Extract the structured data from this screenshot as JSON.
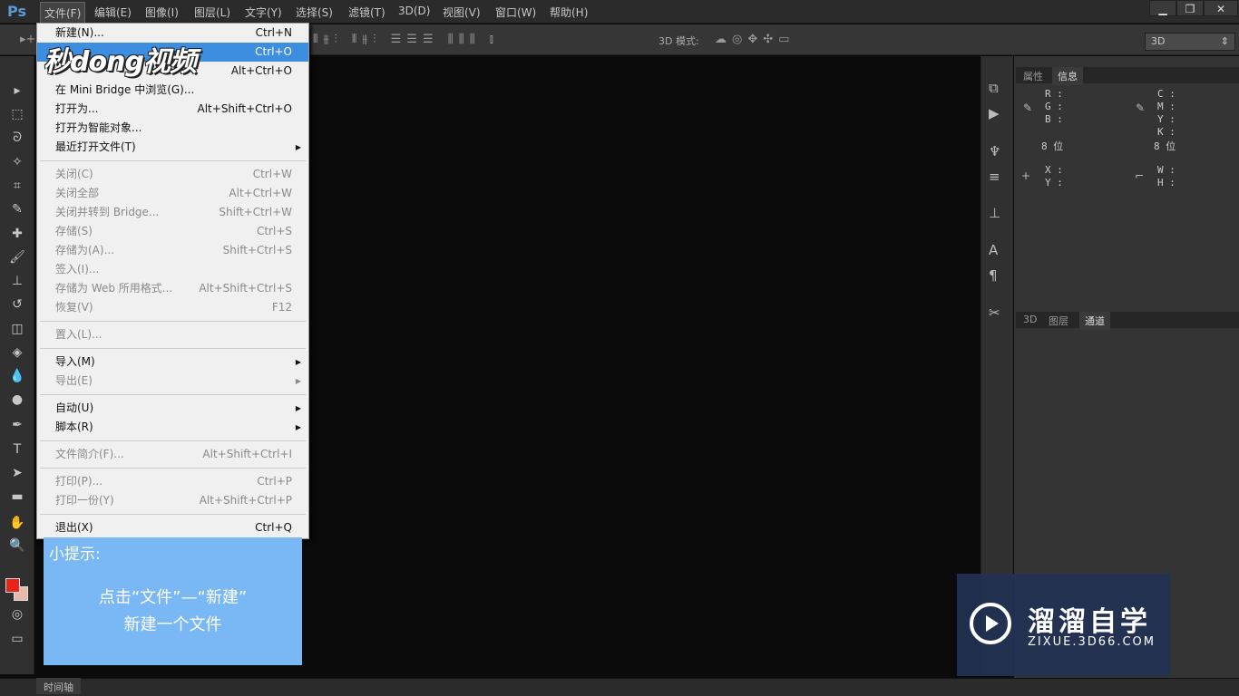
{
  "app": {
    "logo": "Ps"
  },
  "menubar": [
    "文件(F)",
    "编辑(E)",
    "图像(I)",
    "图层(L)",
    "文字(Y)",
    "选择(S)",
    "滤镜(T)",
    "3D(D)",
    "视图(V)",
    "窗口(W)",
    "帮助(H)"
  ],
  "window_controls": {
    "minimize": "▁",
    "restore": "❐",
    "close": "✕"
  },
  "options_bar": {
    "mode_label": "3D 模式:",
    "workspace_select": "3D"
  },
  "file_menu": [
    {
      "label": "新建(N)...",
      "shortcut": "Ctrl+N"
    },
    {
      "label": "",
      "shortcut": "Ctrl+O",
      "highlighted": true
    },
    {
      "label": "",
      "shortcut": "Alt+Ctrl+O"
    },
    {
      "label": "在 Mini Bridge 中浏览(G)...",
      "shortcut": ""
    },
    {
      "label": "打开为...",
      "shortcut": "Alt+Shift+Ctrl+O"
    },
    {
      "label": "打开为智能对象...",
      "shortcut": ""
    },
    {
      "label": "最近打开文件(T)",
      "shortcut": "",
      "submenu": true
    },
    {
      "separator": true
    },
    {
      "label": "关闭(C)",
      "shortcut": "Ctrl+W",
      "disabled": true
    },
    {
      "label": "关闭全部",
      "shortcut": "Alt+Ctrl+W",
      "disabled": true
    },
    {
      "label": "关闭并转到 Bridge...",
      "shortcut": "Shift+Ctrl+W",
      "disabled": true
    },
    {
      "label": "存储(S)",
      "shortcut": "Ctrl+S",
      "disabled": true
    },
    {
      "label": "存储为(A)...",
      "shortcut": "Shift+Ctrl+S",
      "disabled": true
    },
    {
      "label": "签入(I)...",
      "shortcut": "",
      "disabled": true
    },
    {
      "label": "存储为 Web 所用格式...",
      "shortcut": "Alt+Shift+Ctrl+S",
      "disabled": true
    },
    {
      "label": "恢复(V)",
      "shortcut": "F12",
      "disabled": true
    },
    {
      "separator": true
    },
    {
      "label": "置入(L)...",
      "shortcut": "",
      "disabled": true
    },
    {
      "separator": true
    },
    {
      "label": "导入(M)",
      "shortcut": "",
      "submenu": true
    },
    {
      "label": "导出(E)",
      "shortcut": "",
      "submenu": true,
      "disabled": true
    },
    {
      "separator": true
    },
    {
      "label": "自动(U)",
      "shortcut": "",
      "submenu": true
    },
    {
      "label": "脚本(R)",
      "shortcut": "",
      "submenu": true
    },
    {
      "separator": true
    },
    {
      "label": "文件简介(F)...",
      "shortcut": "Alt+Shift+Ctrl+I",
      "disabled": true
    },
    {
      "separator": true
    },
    {
      "label": "打印(P)...",
      "shortcut": "Ctrl+P",
      "disabled": true
    },
    {
      "label": "打印一份(Y)",
      "shortcut": "Alt+Shift+Ctrl+P",
      "disabled": true
    },
    {
      "separator": true
    },
    {
      "label": "退出(X)",
      "shortcut": "Ctrl+Q"
    }
  ],
  "overlay_logo": "秒dong视频",
  "tip": {
    "title": "小提示:",
    "line1": "点击“文件”—“新建”",
    "line2": "新建一个文件"
  },
  "watermark": {
    "name": "溜溜自学",
    "url": "ZIXUE.3D66.COM"
  },
  "right_panel": {
    "top_tabs": [
      "属性",
      "信息"
    ],
    "active_top": "信息",
    "info": {
      "rgb": [
        "R :",
        "G :",
        "B :"
      ],
      "cmyk": [
        "C :",
        "M :",
        "Y :",
        "K :"
      ],
      "bits_left": "8 位",
      "bits_right": "8 位",
      "xy": [
        "X :",
        "Y :"
      ],
      "wh": [
        "W :",
        "H :"
      ]
    },
    "bottom_tabs": [
      "3D",
      "图层",
      "通道"
    ],
    "active_bottom": "通道"
  },
  "bottom": {
    "timeline": "时间轴"
  },
  "colors": {
    "foreground": "#e8231a",
    "background": "#e8b8a8",
    "menu_highlight": "#3d8ee0",
    "tip_bg": "#79b8f4"
  }
}
